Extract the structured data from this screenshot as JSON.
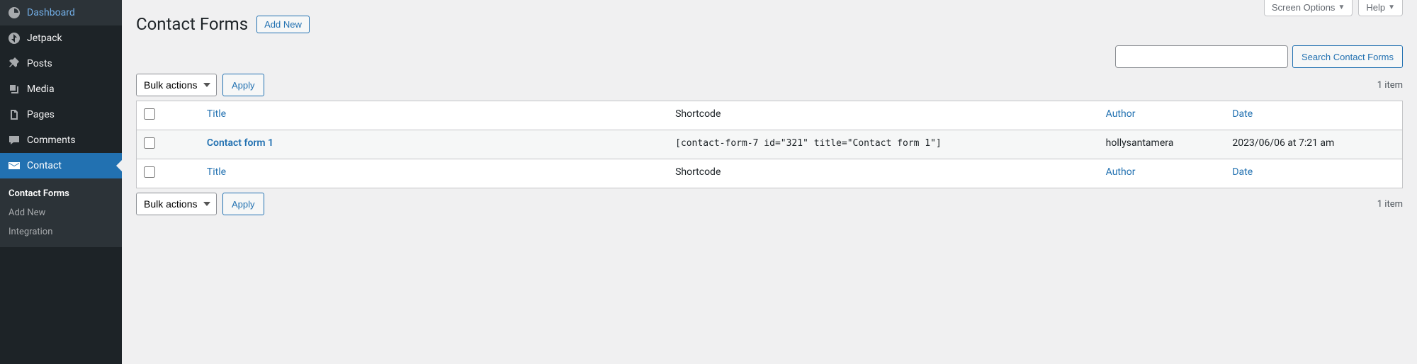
{
  "topbar": {
    "screen_options": "Screen Options",
    "help": "Help"
  },
  "sidebar": {
    "items": [
      {
        "label": "Dashboard",
        "icon": "dashboard"
      },
      {
        "label": "Jetpack",
        "icon": "jetpack"
      },
      {
        "label": "Posts",
        "icon": "posts"
      },
      {
        "label": "Media",
        "icon": "media"
      },
      {
        "label": "Pages",
        "icon": "pages"
      },
      {
        "label": "Comments",
        "icon": "comments"
      },
      {
        "label": "Contact",
        "icon": "contact"
      }
    ],
    "submenu": [
      {
        "label": "Contact Forms",
        "current": true
      },
      {
        "label": "Add New",
        "current": false
      },
      {
        "label": "Integration",
        "current": false
      }
    ]
  },
  "heading": {
    "title": "Contact Forms",
    "add_new": "Add New"
  },
  "search": {
    "button": "Search Contact Forms"
  },
  "bulk": {
    "select_label": "Bulk actions",
    "apply": "Apply"
  },
  "pagination": {
    "count": "1 item"
  },
  "table": {
    "headers": {
      "title": "Title",
      "shortcode": "Shortcode",
      "author": "Author",
      "date": "Date"
    },
    "rows": [
      {
        "title": "Contact form 1",
        "shortcode": "[contact-form-7 id=\"321\" title=\"Contact form 1\"]",
        "author": "hollysantamera",
        "date": "2023/06/06 at 7:21 am"
      }
    ]
  }
}
